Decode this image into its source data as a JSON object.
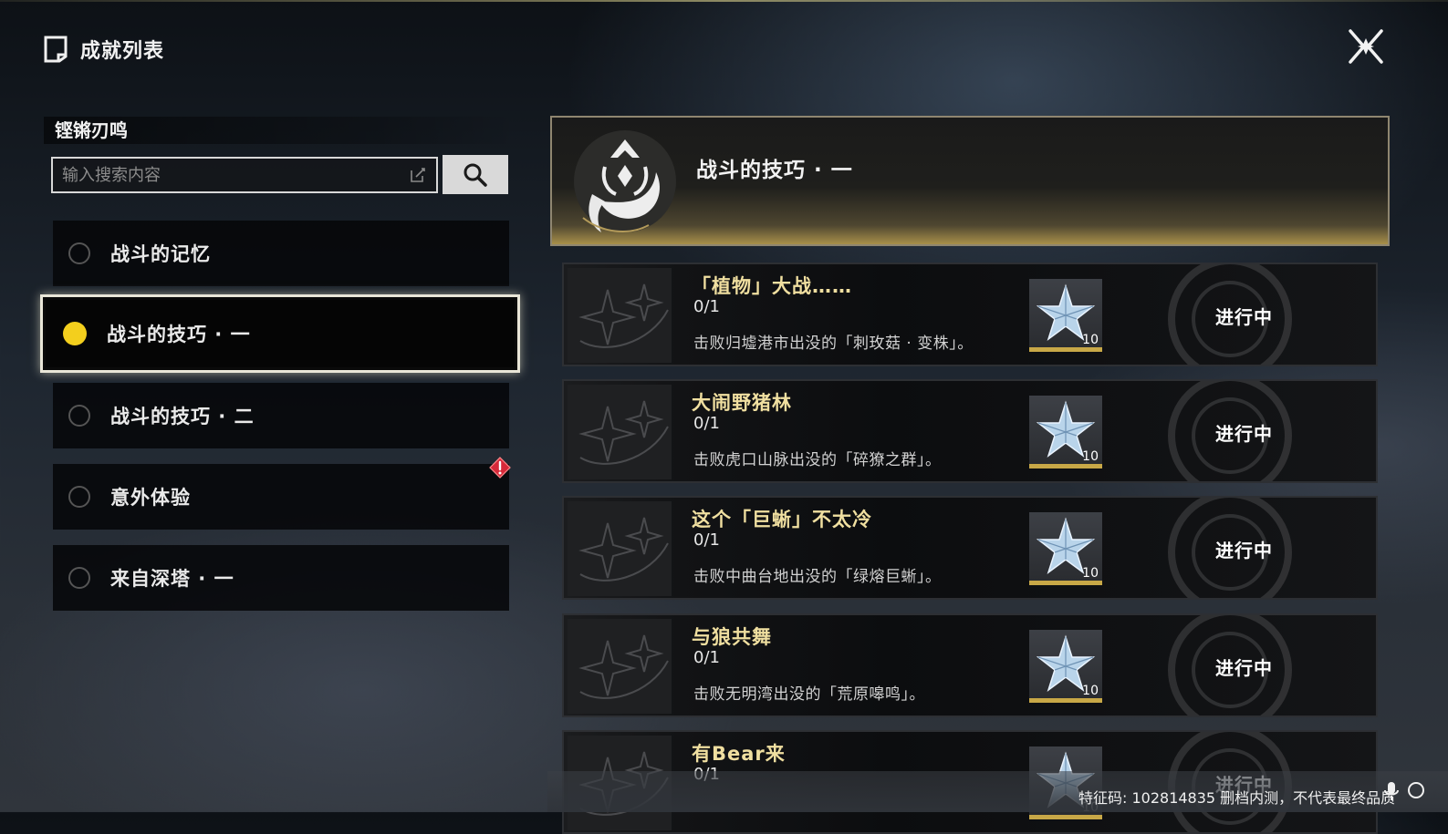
{
  "header": {
    "title": "成就列表"
  },
  "category": {
    "title": "铿锵刃鸣"
  },
  "search": {
    "placeholder": "输入搜索内容",
    "value": ""
  },
  "sidebar": {
    "items": [
      {
        "label": "战斗的记忆",
        "selected": false
      },
      {
        "label": "战斗的技巧 · 一",
        "selected": true
      },
      {
        "label": "战斗的技巧 · 二",
        "selected": false
      },
      {
        "label": "意外体验",
        "selected": false,
        "alert": true
      },
      {
        "label": "来自深塔 · 一",
        "selected": false
      }
    ]
  },
  "banner": {
    "title": "战斗的技巧 · 一"
  },
  "achievements": [
    {
      "name": "「植物」大战……",
      "progress": "0/1",
      "desc": "击败归墟港市出没的「刺玫菇 · 变株」。",
      "reward_qty": "10",
      "status": "进行中"
    },
    {
      "name": "大闹野猪林",
      "progress": "0/1",
      "desc": "击败虎口山脉出没的「碎獠之群」。",
      "reward_qty": "10",
      "status": "进行中"
    },
    {
      "name": "这个「巨蜥」不太冷",
      "progress": "0/1",
      "desc": "击败中曲台地出没的「绿熔巨蜥」。",
      "reward_qty": "10",
      "status": "进行中"
    },
    {
      "name": "与狼共舞",
      "progress": "0/1",
      "desc": "击败无明湾出没的「荒原嗥鸣」。",
      "reward_qty": "10",
      "status": "进行中"
    },
    {
      "name": "有Bear来",
      "progress": "0/1",
      "desc": "",
      "reward_qty": "10",
      "status": "进行中"
    }
  ],
  "footer": {
    "watermark": "特征码: 102814835  删档内测，不代表最终品质"
  },
  "colors": {
    "accent_gold": "#f3cf1d",
    "title_gold": "#f0dfa0",
    "reward_border": "#c8a847"
  },
  "icons": [
    "achievement-list-icon",
    "close-icon",
    "search-icon",
    "edit-icon",
    "alert-icon",
    "emblem-icon",
    "star-crystal-icon",
    "mic-icon",
    "circle-icon"
  ]
}
